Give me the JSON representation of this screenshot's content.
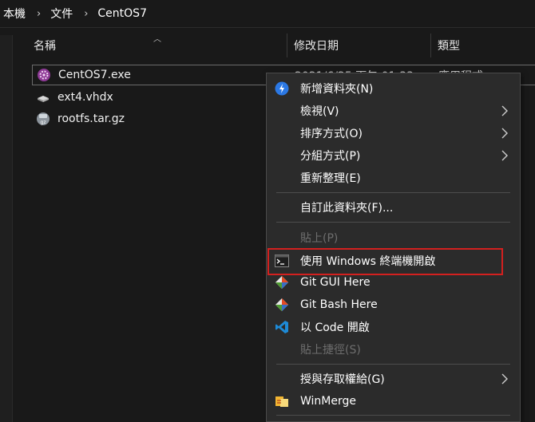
{
  "breadcrumb": [
    "本機",
    "文件",
    "CentOS7"
  ],
  "columns": {
    "name": "名稱",
    "date": "修改日期",
    "type": "類型"
  },
  "files": [
    {
      "name": "CentOS7.exe",
      "date_peek": "2021/6/25 下午 01:33",
      "type_peek": "應用程式"
    },
    {
      "name": "ext4.vhdx"
    },
    {
      "name": "rootfs.tar.gz"
    }
  ],
  "context_menu": {
    "new_folder": "新增資料夾(N)",
    "view": "檢視(V)",
    "sort_by": "排序方式(O)",
    "group_by": "分組方式(P)",
    "refresh": "重新整理(E)",
    "customize": "自訂此資料夾(F)...",
    "paste": "貼上(P)",
    "open_terminal": "使用 Windows 終端機開啟",
    "git_gui": "Git GUI Here",
    "git_bash": "Git Bash Here",
    "open_code": "以 Code 開啟",
    "paste_shortcut": "貼上捷徑(S)",
    "give_access": "授與存取權給(G)",
    "winmerge": "WinMerge"
  },
  "colors": {
    "highlight": "#d3201f",
    "menu_bg": "#2b2b2b"
  }
}
